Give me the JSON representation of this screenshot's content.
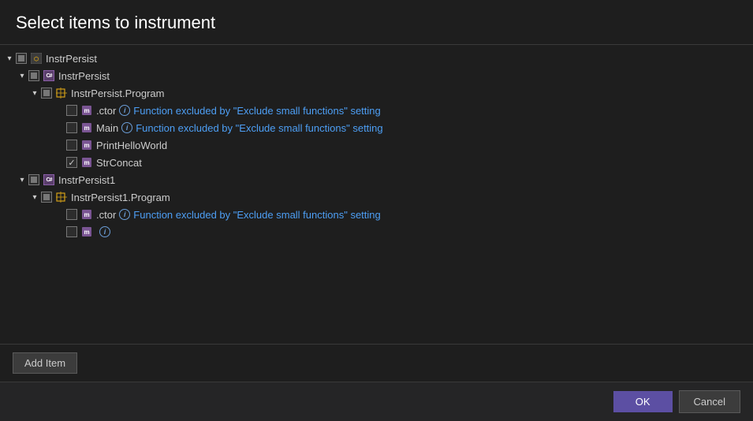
{
  "dialog": {
    "title": "Select items to instrument"
  },
  "buttons": {
    "add_item": "Add Item",
    "ok": "OK",
    "cancel": "Cancel"
  },
  "exclude_text": "Function excluded by \"Exclude small functions\" setting",
  "tree": [
    {
      "id": "instrpersist-root",
      "label": "InstrPersist",
      "type": "root",
      "indent": 0,
      "checkbox": "indeterminate",
      "collapsed": false,
      "icon": "assembly"
    },
    {
      "id": "instrpersist-assembly",
      "label": "InstrPersist",
      "type": "assembly",
      "indent": 1,
      "checkbox": "indeterminate",
      "collapsed": false,
      "icon": "cs-assembly"
    },
    {
      "id": "instrpersist-program",
      "label": "InstrPersist.Program",
      "type": "class",
      "indent": 2,
      "checkbox": "indeterminate",
      "collapsed": false,
      "icon": "namespace"
    },
    {
      "id": "instrpersist-ctor",
      "label": ".ctor",
      "type": "method",
      "indent": 3,
      "checkbox": "unchecked",
      "icon": "method",
      "excluded": true
    },
    {
      "id": "instrpersist-main",
      "label": "Main",
      "type": "method",
      "indent": 3,
      "checkbox": "unchecked",
      "icon": "method",
      "excluded": true
    },
    {
      "id": "instrpersist-printhelloworld",
      "label": "PrintHelloWorld",
      "type": "method",
      "indent": 3,
      "checkbox": "unchecked",
      "icon": "method",
      "excluded": false
    },
    {
      "id": "instrpersist-strconcat",
      "label": "StrConcat",
      "type": "method",
      "indent": 3,
      "checkbox": "checked",
      "icon": "method",
      "excluded": false
    },
    {
      "id": "instrpersist1-root",
      "label": "InstrPersist1",
      "type": "assembly",
      "indent": 1,
      "checkbox": "indeterminate",
      "collapsed": false,
      "icon": "cs-assembly"
    },
    {
      "id": "instrpersist1-program",
      "label": "InstrPersist1.Program",
      "type": "class",
      "indent": 2,
      "checkbox": "indeterminate",
      "collapsed": false,
      "icon": "namespace"
    },
    {
      "id": "instrpersist1-ctor",
      "label": ".ctor",
      "type": "method",
      "indent": 3,
      "checkbox": "unchecked",
      "icon": "method",
      "excluded": true
    }
  ]
}
